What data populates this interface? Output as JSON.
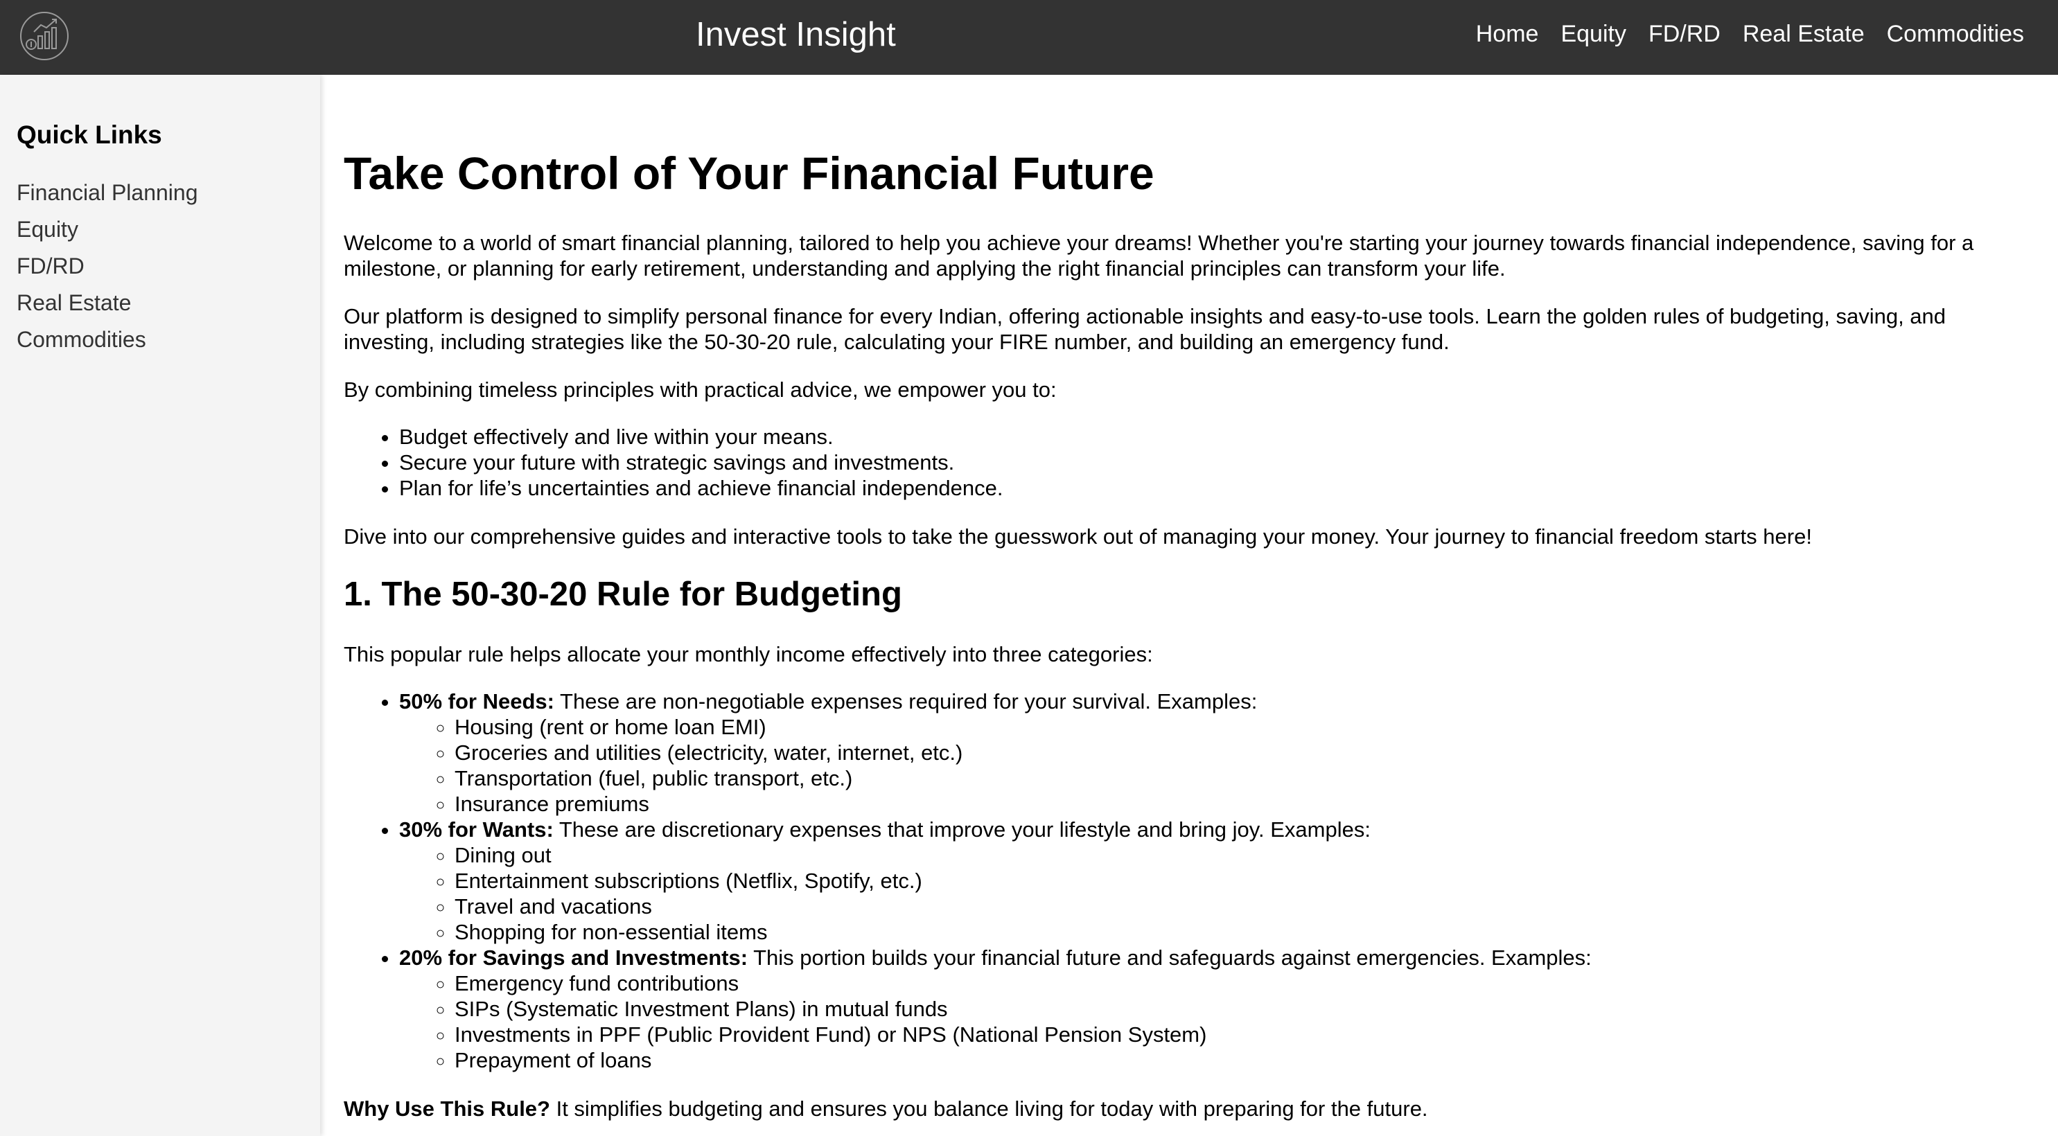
{
  "header": {
    "logo_icon": "investment-growth-logo-icon",
    "title": "Invest Insight",
    "nav": [
      "Home",
      "Equity",
      "FD/RD",
      "Real Estate",
      "Commodities"
    ]
  },
  "sidebar": {
    "heading": "Quick Links",
    "items": [
      "Financial Planning",
      "Equity",
      "FD/RD",
      "Real Estate",
      "Commodities"
    ]
  },
  "main": {
    "title": "Take Control of Your Financial Future",
    "intro1": "Welcome to a world of smart financial planning, tailored to help you achieve your dreams! Whether you're starting your journey towards financial independence, saving for a milestone, or planning for early retirement, understanding and applying the right financial principles can transform your life.",
    "intro2": "Our platform is designed to simplify personal finance for every Indian, offering actionable insights and easy-to-use tools. Learn the golden rules of budgeting, saving, and investing, including strategies like the 50-30-20 rule, calculating your FIRE number, and building an emergency fund.",
    "intro3": "By combining timeless principles with practical advice, we empower you to:",
    "empower_list": [
      "Budget effectively and live within your means.",
      "Secure your future with strategic savings and investments.",
      "Plan for life’s uncertainties and achieve financial independence."
    ],
    "intro4": "Dive into our comprehensive guides and interactive tools to take the guesswork out of managing your money. Your journey to financial freedom starts here!",
    "section1": {
      "heading": "1. The 50-30-20 Rule for Budgeting",
      "lead": "This popular rule helps allocate your monthly income effectively into three categories:",
      "categories": [
        {
          "label": "50% for Needs:",
          "text": " These are non-negotiable expenses required for your survival. Examples:",
          "examples": [
            "Housing (rent or home loan EMI)",
            "Groceries and utilities (electricity, water, internet, etc.)",
            "Transportation (fuel, public transport, etc.)",
            "Insurance premiums"
          ]
        },
        {
          "label": "30% for Wants:",
          "text": " These are discretionary expenses that improve your lifestyle and bring joy. Examples:",
          "examples": [
            "Dining out",
            "Entertainment subscriptions (Netflix, Spotify, etc.)",
            "Travel and vacations",
            "Shopping for non-essential items"
          ]
        },
        {
          "label": "20% for Savings and Investments:",
          "text": " This portion builds your financial future and safeguards against emergencies. Examples:",
          "examples": [
            "Emergency fund contributions",
            "SIPs (Systematic Investment Plans) in mutual funds",
            "Investments in PPF (Public Provident Fund) or NPS (National Pension System)",
            "Prepayment of loans"
          ]
        }
      ],
      "why_label": "Why Use This Rule?",
      "why_text": " It simplifies budgeting and ensures you balance living for today with preparing for the future."
    }
  }
}
